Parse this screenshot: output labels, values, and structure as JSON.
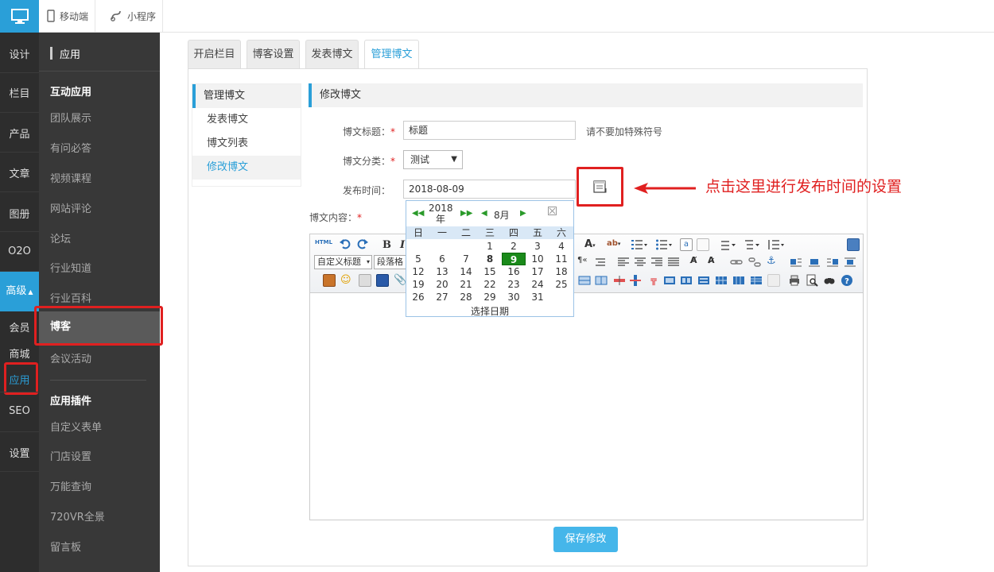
{
  "topbar": {
    "mobile_label": "移动端",
    "miniapp_label": "小程序"
  },
  "leftnav": {
    "items": [
      "设计",
      "栏目",
      "产品",
      "文章",
      "图册",
      "O2O",
      "高级"
    ],
    "sub_items": [
      "会员",
      "商城",
      "应用",
      "SEO",
      "设置"
    ]
  },
  "secnav": {
    "title": "应用",
    "group1": "互动应用",
    "items1": [
      "团队展示",
      "有问必答",
      "视频课程",
      "网站评论",
      "论坛",
      "行业知道",
      "行业百科"
    ],
    "active": "博客",
    "items1b": [
      "会议活动"
    ],
    "group2": "应用插件",
    "items2": [
      "自定义表单",
      "门店设置",
      "万能查询",
      "720VR全景",
      "留言板"
    ]
  },
  "tabs": [
    "开启栏目",
    "博客设置",
    "发表博文",
    "管理博文"
  ],
  "inner_side": {
    "head": "管理博文",
    "items": [
      "发表博文",
      "博文列表",
      "修改博文"
    ]
  },
  "form": {
    "head": "修改博文",
    "title_label": "博文标题：",
    "title_value": "标题",
    "title_hint": "请不要加特殊符号",
    "cat_label": "博文分类：",
    "cat_value": "测试",
    "date_label": "发布时间：",
    "date_value": "2018-08-09",
    "content_label": "博文内容：",
    "required_mark": "*"
  },
  "editor": {
    "custom_title_select": "自定义标题",
    "paragraph_select": "段落格"
  },
  "calendar": {
    "year": "2018",
    "year_suffix": "年",
    "month": "8月",
    "weekdays": [
      "日",
      "一",
      "二",
      "三",
      "四",
      "五",
      "六"
    ],
    "days": [
      "1",
      "2",
      "3",
      "4",
      "5",
      "6",
      "7",
      "8",
      "9",
      "10",
      "11",
      "12",
      "13",
      "14",
      "15",
      "16",
      "17",
      "18",
      "19",
      "20",
      "21",
      "22",
      "23",
      "24",
      "25",
      "26",
      "27",
      "28",
      "29",
      "30",
      "31"
    ],
    "today": "8",
    "selected": "9",
    "footer": "选择日期"
  },
  "annotation": "点击这里进行发布时间的设置",
  "save_label": "保存修改",
  "colors": {
    "accent": "#2a9fd8",
    "annotation_red": "#e02020",
    "calendar_selected": "#1a8a1a"
  }
}
